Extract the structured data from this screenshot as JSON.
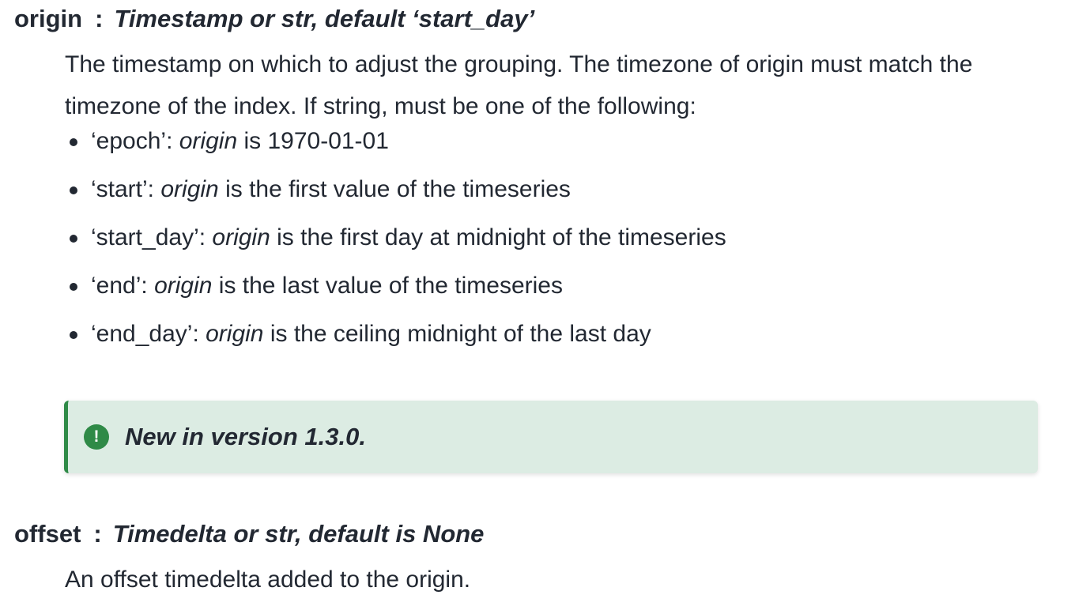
{
  "params": [
    {
      "name": "origin",
      "separator": ":",
      "type": "Timestamp or str, default ‘start_day’",
      "description": "The timestamp on which to adjust the grouping. The timezone of origin must match the timezone of the index. If string, must be one of the following:",
      "options": [
        {
          "key": "‘epoch’: ",
          "term": "origin",
          "text": " is 1970-01-01"
        },
        {
          "key": "‘start’: ",
          "term": "origin",
          "text": " is the first value of the timeseries"
        },
        {
          "key": "‘start_day’: ",
          "term": "origin",
          "text": " is the first day at midnight of the timeseries"
        },
        {
          "key": "‘end’: ",
          "term": "origin",
          "text": " is the last value of the timeseries"
        },
        {
          "key": "‘end_day’: ",
          "term": "origin",
          "text": " is the ceiling midnight of the last day"
        }
      ],
      "admonition": {
        "icon": "exclamation-circle-icon",
        "icon_glyph": "!",
        "text": "New in version 1.3.0."
      }
    },
    {
      "name": "offset",
      "separator": ":",
      "type": "Timedelta or str, default is None",
      "description": "An offset timedelta added to the origin."
    }
  ],
  "colors": {
    "text": "#222832",
    "admonition_bg": "#dcece3",
    "admonition_accent": "#2f8a47"
  }
}
